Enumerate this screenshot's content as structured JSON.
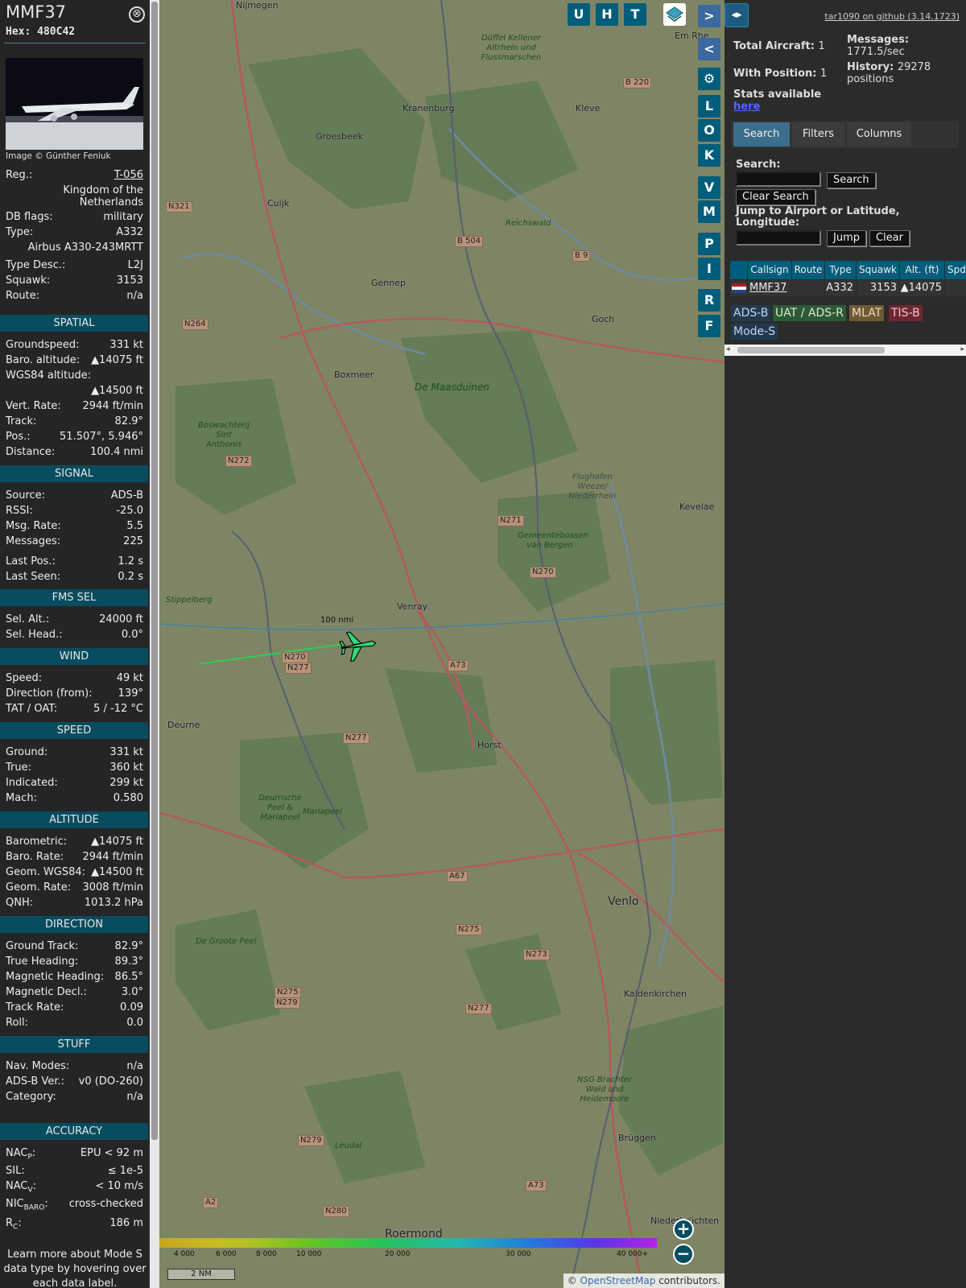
{
  "header": {
    "callsign": "MMF37",
    "hex_label": "Hex:",
    "hex": "480C42",
    "close_glyph": "⊗"
  },
  "photo": {
    "credit": "Image © Günther Feniuk"
  },
  "info": {
    "reg_label": "Reg.:",
    "reg": "T-056",
    "country_line1": "Kingdom of the",
    "country_line2": "Netherlands",
    "dbflags_label": "DB flags:",
    "dbflags": "military",
    "type_label": "Type:",
    "type": "A332",
    "type_full": "Airbus A330-243MRTT",
    "typedesc_label": "Type Desc.:",
    "typedesc": "L2J",
    "squawk_label": "Squawk:",
    "squawk": "3153",
    "route_label": "Route:",
    "route": "n/a"
  },
  "spatial": {
    "title": "SPATIAL",
    "gs_label": "Groundspeed:",
    "gs": "331 kt",
    "baro_label": "Baro. altitude:",
    "baro": "▲14075 ft",
    "wgs_label": "WGS84 altitude:",
    "wgs": "▲14500 ft",
    "vr_label": "Vert. Rate:",
    "vr": "2944 ft/min",
    "track_label": "Track:",
    "track": "82.9°",
    "pos_label": "Pos.:",
    "pos": "51.507°, 5.946°",
    "dist_label": "Distance:",
    "dist": "100.4 nmi"
  },
  "signal": {
    "title": "SIGNAL",
    "src_label": "Source:",
    "src": "ADS-B",
    "rssi_label": "RSSI:",
    "rssi": "-25.0",
    "msgrate_label": "Msg. Rate:",
    "msgrate": "5.5",
    "msgs_label": "Messages:",
    "msgs": "225",
    "lastpos_label": "Last Pos.:",
    "lastpos": "1.2 s",
    "lastseen_label": "Last Seen:",
    "lastseen": "0.2 s"
  },
  "fms": {
    "title": "FMS SEL",
    "alt_label": "Sel. Alt.:",
    "alt": "24000 ft",
    "head_label": "Sel. Head.:",
    "head": "0.0°"
  },
  "wind": {
    "title": "WIND",
    "speed_label": "Speed:",
    "speed": "49 kt",
    "dir_label": "Direction (from):",
    "dir": "139°",
    "tat_label": "TAT / OAT:",
    "tat": "5 / -12 °C"
  },
  "speed": {
    "title": "SPEED",
    "ground_label": "Ground:",
    "ground": "331 kt",
    "true_label": "True:",
    "true": "360 kt",
    "ind_label": "Indicated:",
    "ind": "299 kt",
    "mach_label": "Mach:",
    "mach": "0.580"
  },
  "altitude": {
    "title": "ALTITUDE",
    "baro_label": "Barometric:",
    "baro": "▲14075 ft",
    "bararate_label": "Baro. Rate:",
    "bararate": "2944 ft/min",
    "geom_label": "Geom. WGS84:",
    "geom": "▲14500 ft",
    "geomrate_label": "Geom. Rate:",
    "geomrate": "3008 ft/min",
    "qnh_label": "QNH:",
    "qnh": "1013.2 hPa"
  },
  "direction": {
    "title": "DIRECTION",
    "gt_label": "Ground Track:",
    "gt": "82.9°",
    "th_label": "True Heading:",
    "th": "89.3°",
    "mh_label": "Magnetic Heading:",
    "mh": "86.5°",
    "md_label": "Magnetic Decl.:",
    "md": "3.0°",
    "tr_label": "Track Rate:",
    "tr": "0.09",
    "roll_label": "Roll:",
    "roll": "0.0"
  },
  "stuff": {
    "title": "STUFF",
    "nav_label": "Nav. Modes:",
    "nav": "n/a",
    "adsb_label": "ADS-B Ver.:",
    "adsb": "v0 (DO-260)",
    "cat_label": "Category:",
    "cat": "n/a"
  },
  "accuracy": {
    "title": "ACCURACY",
    "nacp_label": "NAC",
    "nacp_sub": "P",
    "nacp": "EPU < 92 m",
    "sil_label": "SIL:",
    "sil": "≤ 1e-5",
    "nacv_label": "NAC",
    "nacv_sub": "V",
    "nacv": "< 10 m/s",
    "nic_label": "NIC",
    "nic_sub": "BARO",
    "nic": "cross-checked",
    "rc_label": "R",
    "rc_sub": "C",
    "rc": "186 m"
  },
  "note": "Learn more about Mode S data type by hovering over each data label.",
  "map": {
    "buttons": [
      "U",
      "H",
      "T"
    ],
    "side_letters": [
      "L",
      "O",
      "K",
      "V",
      "M",
      "P",
      "I",
      "R",
      "F"
    ],
    "range_label": "100 nmi",
    "scale": "2 NM",
    "attribution_prefix": "© ",
    "attribution_link": "OpenStreetMap",
    "attribution_suffix": " contributors.",
    "altitude_legend": [
      "4 000",
      "6 000",
      "8 000",
      "10 000",
      "20 000",
      "30 000",
      "40 000+"
    ],
    "places": [
      {
        "name": "Nijmegen"
      },
      {
        "name": "Kranenburg"
      },
      {
        "name": "Kleve"
      },
      {
        "name": "Groesbeek"
      },
      {
        "name": "Cuijk"
      },
      {
        "name": "Gennep"
      },
      {
        "name": "Goch"
      },
      {
        "name": "Boxmeer"
      },
      {
        "name": "Venray"
      },
      {
        "name": "Deurne"
      },
      {
        "name": "Horst"
      },
      {
        "name": "Venlo"
      },
      {
        "name": "Kaldenkirchen"
      },
      {
        "name": "Brüggen"
      },
      {
        "name": "Roermond"
      },
      {
        "name": "Kevelae"
      },
      {
        "name": "Niederkrüchten"
      },
      {
        "name": "Em Rhe"
      }
    ],
    "parks": [
      {
        "name": "Düffel Kellener Altrhein und Flussmarschen"
      },
      {
        "name": "De Maasduinen"
      },
      {
        "name": "Boswachterij Sint Anthonis"
      },
      {
        "name": "Gemeentebossen van Bergen"
      },
      {
        "name": "Stippelberg"
      },
      {
        "name": "Deurnsche Peel & Mariapeel"
      },
      {
        "name": "Mariapeel"
      },
      {
        "name": "De Groote Peel"
      },
      {
        "name": "Leudal"
      },
      {
        "name": "NSG Brachter Wald und Heidemoore"
      },
      {
        "name": "Reichswald"
      },
      {
        "name": "Flughafen Weeze/ Niederrhein"
      }
    ],
    "roads": [
      "N321",
      "B 504",
      "B 9",
      "B 220",
      "N264",
      "N272",
      "N271",
      "N270",
      "N270",
      "N277",
      "A73",
      "N277",
      "A67",
      "N275",
      "N273",
      "N275",
      "N279",
      "N277",
      "A73",
      "N279",
      "A2",
      "N280"
    ]
  },
  "right": {
    "github": "tar1090 on github (3.14.1723)",
    "total_label": "Total Aircraft:",
    "total": "1",
    "msgs_label": "Messages:",
    "msgs": "1771.5/sec",
    "withpos_label": "With Position:",
    "withpos": "1",
    "hist_label": "History:",
    "hist": "29278 positions",
    "stats_text": "Stats available",
    "stats_link": "here",
    "tabs": [
      "Search",
      "Filters",
      "Columns"
    ],
    "search_label": "Search:",
    "search_button": "Search",
    "clear_search": "Clear Search",
    "jump_label": "Jump to Airport or Latitude, Longitude:",
    "jump_button": "Jump",
    "clear_button": "Clear",
    "columns": [
      "Callsign",
      "Route",
      "Type",
      "Squawk",
      "Alt. (ft)",
      "Spd"
    ],
    "row": {
      "callsign": "MMF37",
      "route": "",
      "type": "A332",
      "squawk": "3153",
      "alt": "▲14075"
    },
    "chips": [
      "ADS-B",
      "UAT / ADS-R",
      "MLAT",
      "TIS-B",
      "Mode-S"
    ],
    "colors": {
      "adsb": "#233a4e",
      "uat": "#2c5a34",
      "mlat": "#6d5a33",
      "tisb": "#6e2630",
      "modes": "#233a4e"
    }
  }
}
